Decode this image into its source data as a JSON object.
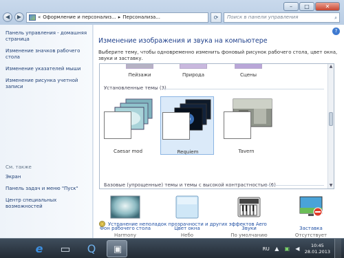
{
  "window": {
    "breadcrumb": {
      "seg1": "Оформление и персонализ...",
      "seg2": "Персонализа..."
    },
    "search_placeholder": "Поиск в панели управления"
  },
  "sidebar": {
    "home": "Панель управления - домашняя страница",
    "links": [
      "Изменение значков рабочего стола",
      "Изменение указателей мыши",
      "Изменение рисунка учетной записи"
    ],
    "see_also_label": "См. также",
    "see_also": [
      "Экран",
      "Панель задач и меню \"Пуск\"",
      "Центр специальных возможностей"
    ]
  },
  "main": {
    "title": "Изменение изображения и звука на компьютере",
    "description": "Выберите тему, чтобы одновременно изменить фоновый рисунок рабочего стола, цвет окна, звуки и заставку.",
    "top_row_labels": [
      "Пейзажи",
      "Природа",
      "Сцены"
    ],
    "installed_group": "Установленные темы (3)",
    "installed_themes": [
      "Caesar mod",
      "Requiem",
      "Tavern"
    ],
    "basic_group": "Базовые (упрощенные) темы и темы с высокой контрастностью (6)",
    "bottom": [
      {
        "caption": "Фон рабочего стола",
        "sub": "Harmony"
      },
      {
        "caption": "Цвет окна",
        "sub": "Небо"
      },
      {
        "caption": "Звуки",
        "sub": "По умолчанию"
      },
      {
        "caption": "Заставка",
        "sub": "Отсутствует"
      }
    ],
    "troubleshoot": "Устранение неполадок прозрачности и других эффектов Aero"
  },
  "taskbar": {
    "language": "RU",
    "time": "10:45",
    "date": "28.01.2013"
  }
}
